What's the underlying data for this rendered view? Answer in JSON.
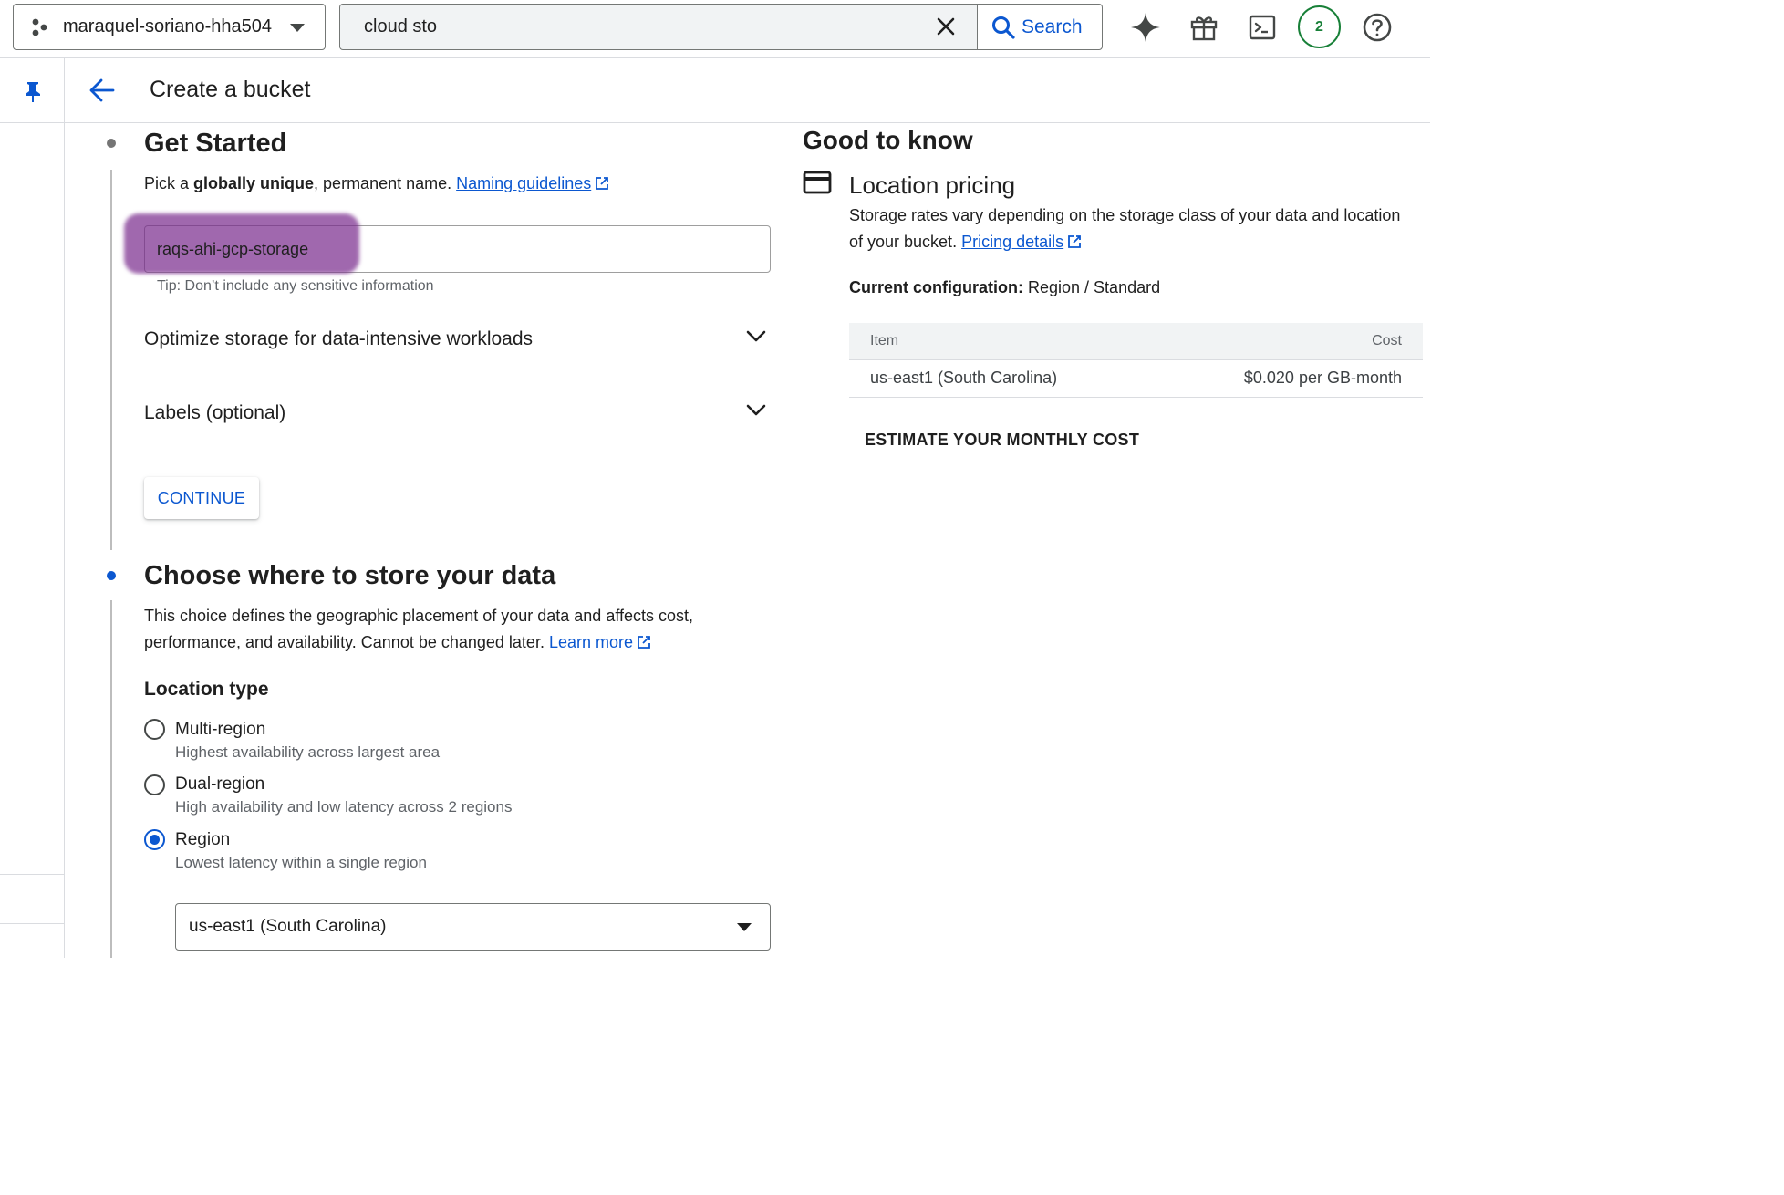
{
  "topbar": {
    "project_name": "maraquel-soriano-hha504",
    "search_value": "cloud sto",
    "search_button_label": "Search",
    "notification_count": "2"
  },
  "header": {
    "title": "Create a bucket"
  },
  "get_started": {
    "heading": "Get Started",
    "pick_prefix": "Pick a ",
    "pick_bold": "globally unique",
    "pick_suffix": ", permanent name. ",
    "naming_link": "Naming guidelines",
    "bucket_name_value": "raqs-ahi-gcp-storage",
    "tip": "Tip: Don’t include any sensitive information",
    "optimize_label": "Optimize storage for data-intensive workloads",
    "labels_label": "Labels (optional)",
    "continue_label": "CONTINUE"
  },
  "location": {
    "heading": "Choose where to store your data",
    "desc_line1": "This choice defines the geographic placement of your data and affects cost,",
    "desc_line2": "performance, and availability. Cannot be changed later. ",
    "learn_more_link": "Learn more",
    "location_type_title": "Location type",
    "options": [
      {
        "label": "Multi-region",
        "description": "Highest availability across largest area",
        "checked": false
      },
      {
        "label": "Dual-region",
        "description": "High availability and low latency across 2 regions",
        "checked": false
      },
      {
        "label": "Region",
        "description": "Lowest latency within a single region",
        "checked": true
      }
    ],
    "region_value": "us-east1 (South Carolina)"
  },
  "good_to_know": {
    "heading": "Good to know",
    "pricing_title": "Location pricing",
    "pricing_desc_line1": "Storage rates vary depending on the storage class of your data and location",
    "pricing_desc_line2": "of your bucket. ",
    "pricing_link": "Pricing details",
    "current_config_label": "Current configuration:",
    "current_config_value": " Region / Standard",
    "table": {
      "headers": [
        "Item",
        "Cost"
      ],
      "rows": [
        [
          "us-east1 (South Carolina)",
          "$0.020 per GB-month"
        ]
      ]
    },
    "estimate_label": "ESTIMATE YOUR MONTHLY COST"
  },
  "colors": {
    "accent": "#0b57d0",
    "badge_green": "#188038",
    "redaction": "#8e3fa0"
  },
  "icons": [
    "project-icon",
    "caret-down-icon",
    "close-icon",
    "search-icon",
    "gemini-spark-icon",
    "gift-icon",
    "cloud-shell-icon",
    "help-icon",
    "pin-icon",
    "back-arrow-icon",
    "external-link-icon",
    "chevron-down-icon",
    "credit-card-icon"
  ]
}
